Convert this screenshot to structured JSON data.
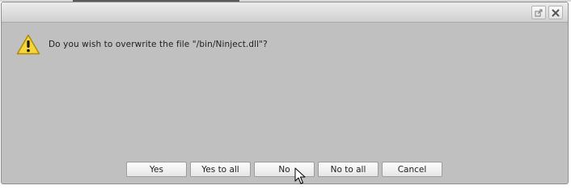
{
  "dialog": {
    "message": "Do you wish to overwrite the file \"/bin/Ninject.dll\"?",
    "icon": "warning-icon"
  },
  "titlebar": {
    "popout_icon": "popout-icon",
    "close_icon": "close-icon"
  },
  "buttons": {
    "yes": "Yes",
    "yes_to_all": "Yes to all",
    "no": "No",
    "no_to_all": "No to all",
    "cancel": "Cancel"
  },
  "colors": {
    "dialog_bg": "#c0c0c0",
    "warning_fill": "#f5d63a",
    "warning_outline": "#b08a00"
  }
}
